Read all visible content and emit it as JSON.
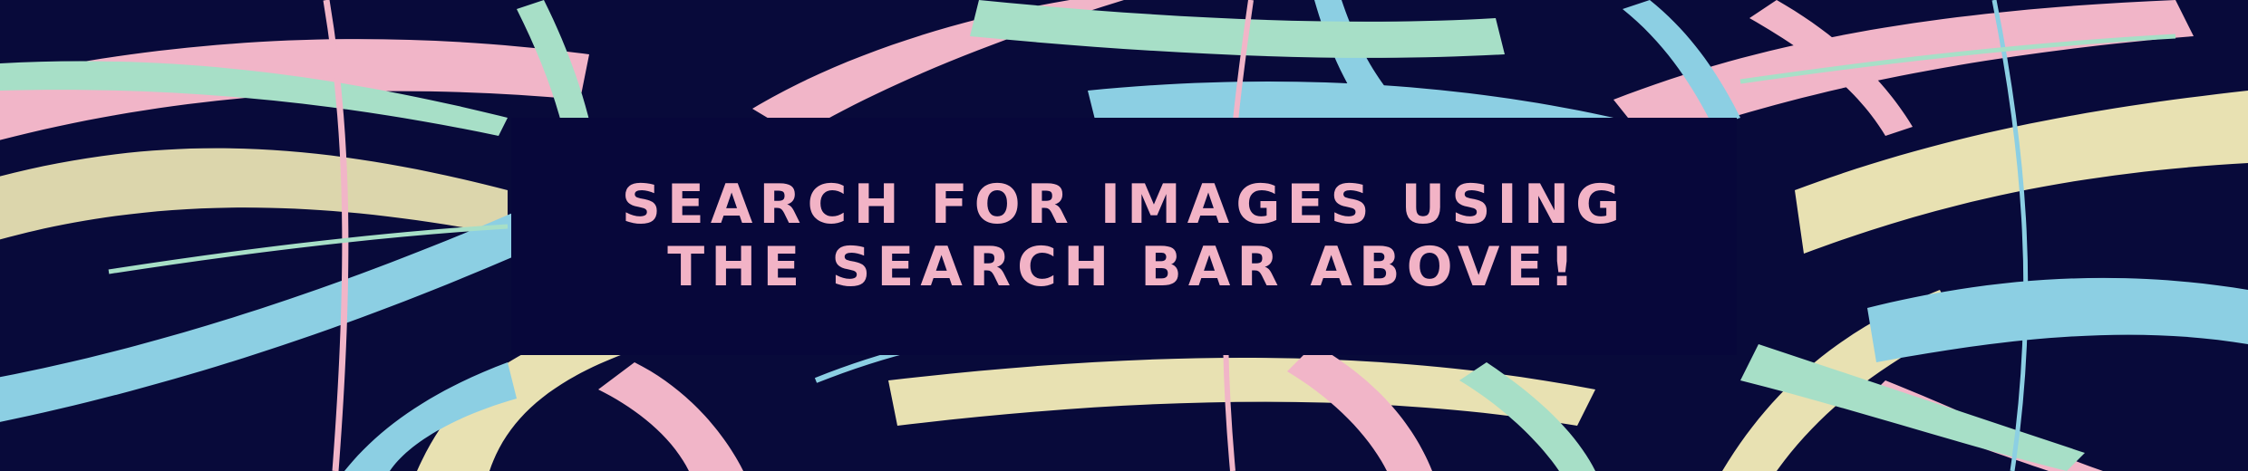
{
  "banner": {
    "line_1": "SEARCH FOR IMAGES USING",
    "line_2": "THE SEARCH BAR ABOVE!"
  },
  "colors": {
    "background": "#080a3a",
    "box": "#07073a",
    "text": "#f2b3c6",
    "brush_pink": "#f1b5c8",
    "brush_blue": "#8ccfe3",
    "brush_mint": "#a7dfc7",
    "brush_yellow": "#e8e1b2"
  }
}
